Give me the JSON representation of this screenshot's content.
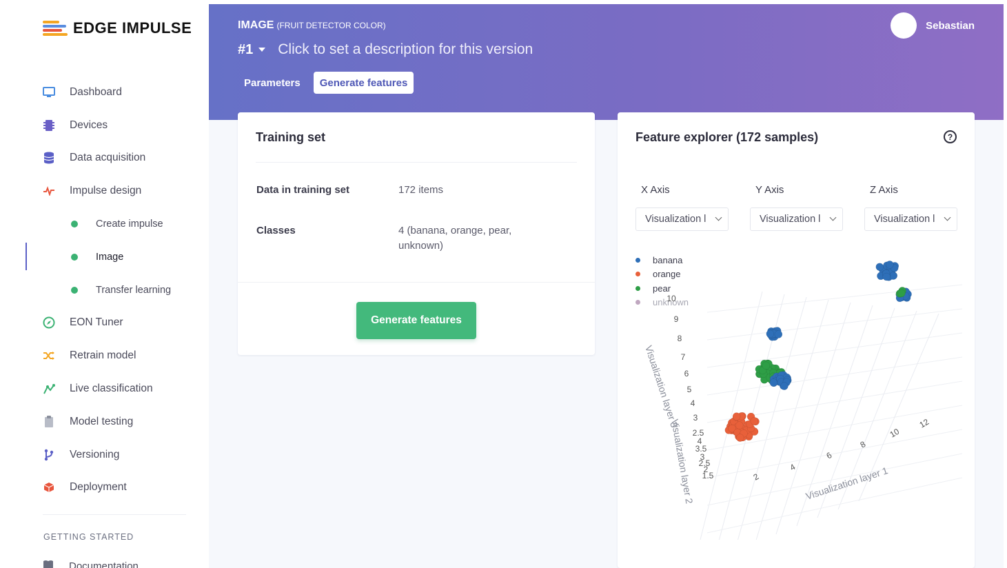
{
  "brand": {
    "name": "EDGE IMPULSE",
    "colors": [
      "#f4a623",
      "#e8553d",
      "#5a8de0",
      "#3bb273"
    ]
  },
  "sidebar": {
    "items": [
      {
        "label": "Dashboard",
        "icon": "monitor-icon",
        "color": "#4a8de0"
      },
      {
        "label": "Devices",
        "icon": "chip-icon",
        "color": "#6a5fc6"
      },
      {
        "label": "Data acquisition",
        "icon": "database-icon",
        "color": "#5a5fc6"
      },
      {
        "label": "Impulse design",
        "icon": "pulse-icon",
        "color": "#e8553d"
      }
    ],
    "subitems": [
      {
        "label": "Create impulse"
      },
      {
        "label": "Image"
      },
      {
        "label": "Transfer learning"
      }
    ],
    "items2": [
      {
        "label": "EON Tuner",
        "icon": "compass-icon",
        "color": "#3bb273"
      },
      {
        "label": "Retrain model",
        "icon": "shuffle-icon",
        "color": "#f4a623"
      },
      {
        "label": "Live classification",
        "icon": "live-icon",
        "color": "#3bb273"
      },
      {
        "label": "Model testing",
        "icon": "clipboard-icon",
        "color": "#9aa0ad"
      },
      {
        "label": "Versioning",
        "icon": "branch-icon",
        "color": "#5a5fc6"
      },
      {
        "label": "Deployment",
        "icon": "box-icon",
        "color": "#e8553d"
      }
    ],
    "section_title": "GETTING STARTED",
    "doc_label": "Documentation"
  },
  "header": {
    "title": "IMAGE",
    "subtitle": "(FRUIT DETECTOR COLOR)",
    "version": "#1",
    "version_description": "Click to set a description for this version",
    "tabs": [
      {
        "label": "Parameters"
      },
      {
        "label": "Generate features"
      }
    ],
    "user_name": "Sebastian"
  },
  "training": {
    "title": "Training set",
    "rows": [
      {
        "key": "Data in training set",
        "value": "172 items"
      },
      {
        "key": "Classes",
        "value": "4 (banana, orange, pear, unknown)"
      }
    ],
    "button_label": "Generate features"
  },
  "explorer": {
    "title": "Feature explorer (172 samples)",
    "help_glyph": "?",
    "axes": [
      {
        "label": "X Axis",
        "value": "Visualization l"
      },
      {
        "label": "Y Axis",
        "value": "Visualization l"
      },
      {
        "label": "Z Axis",
        "value": "Visualization l"
      }
    ]
  },
  "chart_data": {
    "type": "scatter",
    "series": [
      {
        "name": "banana",
        "color": "#2e6fb8"
      },
      {
        "name": "orange",
        "color": "#e8603a"
      },
      {
        "name": "pear",
        "color": "#2e9e46"
      },
      {
        "name": "unknown",
        "color": "#c0a7c0"
      }
    ],
    "z_ticks": [
      "10",
      "9",
      "8",
      "7",
      "6",
      "5",
      "4",
      "3",
      "2.5",
      "4",
      "3.5",
      "3",
      "2.5",
      "2",
      "1.5"
    ],
    "x_ticks": [
      "2",
      "4",
      "6",
      "8",
      "10",
      "12"
    ],
    "axis_labels": [
      "Visualization layer 1",
      "Visualization layer 2",
      "Visualization layer 3"
    ],
    "clusters": [
      {
        "series": 1,
        "cx": 180,
        "cy": 455,
        "spread": 22,
        "count": 45
      },
      {
        "series": 2,
        "cx": 222,
        "cy": 376,
        "spread": 18,
        "count": 38
      },
      {
        "series": 0,
        "cx": 238,
        "cy": 390,
        "spread": 12,
        "count": 22
      },
      {
        "series": 0,
        "cx": 227,
        "cy": 320,
        "spread": 8,
        "count": 12
      },
      {
        "series": 0,
        "cx": 392,
        "cy": 230,
        "spread": 14,
        "count": 20
      },
      {
        "series": 0,
        "cx": 415,
        "cy": 265,
        "spread": 8,
        "count": 10
      },
      {
        "series": 2,
        "cx": 413,
        "cy": 262,
        "spread": 4,
        "count": 3
      }
    ]
  }
}
